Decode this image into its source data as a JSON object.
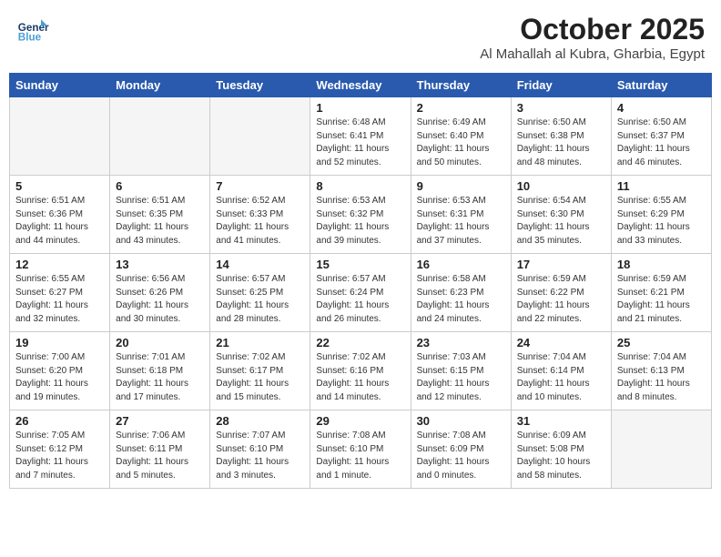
{
  "header": {
    "logo_line1": "General",
    "logo_line2": "Blue",
    "month": "October 2025",
    "location": "Al Mahallah al Kubra, Gharbia, Egypt"
  },
  "weekdays": [
    "Sunday",
    "Monday",
    "Tuesday",
    "Wednesday",
    "Thursday",
    "Friday",
    "Saturday"
  ],
  "weeks": [
    [
      {
        "day": "",
        "sunrise": "",
        "sunset": "",
        "daylight": ""
      },
      {
        "day": "",
        "sunrise": "",
        "sunset": "",
        "daylight": ""
      },
      {
        "day": "",
        "sunrise": "",
        "sunset": "",
        "daylight": ""
      },
      {
        "day": "1",
        "sunrise": "Sunrise: 6:48 AM",
        "sunset": "Sunset: 6:41 PM",
        "daylight": "Daylight: 11 hours and 52 minutes."
      },
      {
        "day": "2",
        "sunrise": "Sunrise: 6:49 AM",
        "sunset": "Sunset: 6:40 PM",
        "daylight": "Daylight: 11 hours and 50 minutes."
      },
      {
        "day": "3",
        "sunrise": "Sunrise: 6:50 AM",
        "sunset": "Sunset: 6:38 PM",
        "daylight": "Daylight: 11 hours and 48 minutes."
      },
      {
        "day": "4",
        "sunrise": "Sunrise: 6:50 AM",
        "sunset": "Sunset: 6:37 PM",
        "daylight": "Daylight: 11 hours and 46 minutes."
      }
    ],
    [
      {
        "day": "5",
        "sunrise": "Sunrise: 6:51 AM",
        "sunset": "Sunset: 6:36 PM",
        "daylight": "Daylight: 11 hours and 44 minutes."
      },
      {
        "day": "6",
        "sunrise": "Sunrise: 6:51 AM",
        "sunset": "Sunset: 6:35 PM",
        "daylight": "Daylight: 11 hours and 43 minutes."
      },
      {
        "day": "7",
        "sunrise": "Sunrise: 6:52 AM",
        "sunset": "Sunset: 6:33 PM",
        "daylight": "Daylight: 11 hours and 41 minutes."
      },
      {
        "day": "8",
        "sunrise": "Sunrise: 6:53 AM",
        "sunset": "Sunset: 6:32 PM",
        "daylight": "Daylight: 11 hours and 39 minutes."
      },
      {
        "day": "9",
        "sunrise": "Sunrise: 6:53 AM",
        "sunset": "Sunset: 6:31 PM",
        "daylight": "Daylight: 11 hours and 37 minutes."
      },
      {
        "day": "10",
        "sunrise": "Sunrise: 6:54 AM",
        "sunset": "Sunset: 6:30 PM",
        "daylight": "Daylight: 11 hours and 35 minutes."
      },
      {
        "day": "11",
        "sunrise": "Sunrise: 6:55 AM",
        "sunset": "Sunset: 6:29 PM",
        "daylight": "Daylight: 11 hours and 33 minutes."
      }
    ],
    [
      {
        "day": "12",
        "sunrise": "Sunrise: 6:55 AM",
        "sunset": "Sunset: 6:27 PM",
        "daylight": "Daylight: 11 hours and 32 minutes."
      },
      {
        "day": "13",
        "sunrise": "Sunrise: 6:56 AM",
        "sunset": "Sunset: 6:26 PM",
        "daylight": "Daylight: 11 hours and 30 minutes."
      },
      {
        "day": "14",
        "sunrise": "Sunrise: 6:57 AM",
        "sunset": "Sunset: 6:25 PM",
        "daylight": "Daylight: 11 hours and 28 minutes."
      },
      {
        "day": "15",
        "sunrise": "Sunrise: 6:57 AM",
        "sunset": "Sunset: 6:24 PM",
        "daylight": "Daylight: 11 hours and 26 minutes."
      },
      {
        "day": "16",
        "sunrise": "Sunrise: 6:58 AM",
        "sunset": "Sunset: 6:23 PM",
        "daylight": "Daylight: 11 hours and 24 minutes."
      },
      {
        "day": "17",
        "sunrise": "Sunrise: 6:59 AM",
        "sunset": "Sunset: 6:22 PM",
        "daylight": "Daylight: 11 hours and 22 minutes."
      },
      {
        "day": "18",
        "sunrise": "Sunrise: 6:59 AM",
        "sunset": "Sunset: 6:21 PM",
        "daylight": "Daylight: 11 hours and 21 minutes."
      }
    ],
    [
      {
        "day": "19",
        "sunrise": "Sunrise: 7:00 AM",
        "sunset": "Sunset: 6:20 PM",
        "daylight": "Daylight: 11 hours and 19 minutes."
      },
      {
        "day": "20",
        "sunrise": "Sunrise: 7:01 AM",
        "sunset": "Sunset: 6:18 PM",
        "daylight": "Daylight: 11 hours and 17 minutes."
      },
      {
        "day": "21",
        "sunrise": "Sunrise: 7:02 AM",
        "sunset": "Sunset: 6:17 PM",
        "daylight": "Daylight: 11 hours and 15 minutes."
      },
      {
        "day": "22",
        "sunrise": "Sunrise: 7:02 AM",
        "sunset": "Sunset: 6:16 PM",
        "daylight": "Daylight: 11 hours and 14 minutes."
      },
      {
        "day": "23",
        "sunrise": "Sunrise: 7:03 AM",
        "sunset": "Sunset: 6:15 PM",
        "daylight": "Daylight: 11 hours and 12 minutes."
      },
      {
        "day": "24",
        "sunrise": "Sunrise: 7:04 AM",
        "sunset": "Sunset: 6:14 PM",
        "daylight": "Daylight: 11 hours and 10 minutes."
      },
      {
        "day": "25",
        "sunrise": "Sunrise: 7:04 AM",
        "sunset": "Sunset: 6:13 PM",
        "daylight": "Daylight: 11 hours and 8 minutes."
      }
    ],
    [
      {
        "day": "26",
        "sunrise": "Sunrise: 7:05 AM",
        "sunset": "Sunset: 6:12 PM",
        "daylight": "Daylight: 11 hours and 7 minutes."
      },
      {
        "day": "27",
        "sunrise": "Sunrise: 7:06 AM",
        "sunset": "Sunset: 6:11 PM",
        "daylight": "Daylight: 11 hours and 5 minutes."
      },
      {
        "day": "28",
        "sunrise": "Sunrise: 7:07 AM",
        "sunset": "Sunset: 6:10 PM",
        "daylight": "Daylight: 11 hours and 3 minutes."
      },
      {
        "day": "29",
        "sunrise": "Sunrise: 7:08 AM",
        "sunset": "Sunset: 6:10 PM",
        "daylight": "Daylight: 11 hours and 1 minute."
      },
      {
        "day": "30",
        "sunrise": "Sunrise: 7:08 AM",
        "sunset": "Sunset: 6:09 PM",
        "daylight": "Daylight: 11 hours and 0 minutes."
      },
      {
        "day": "31",
        "sunrise": "Sunrise: 6:09 AM",
        "sunset": "Sunset: 5:08 PM",
        "daylight": "Daylight: 10 hours and 58 minutes."
      },
      {
        "day": "",
        "sunrise": "",
        "sunset": "",
        "daylight": ""
      }
    ]
  ]
}
